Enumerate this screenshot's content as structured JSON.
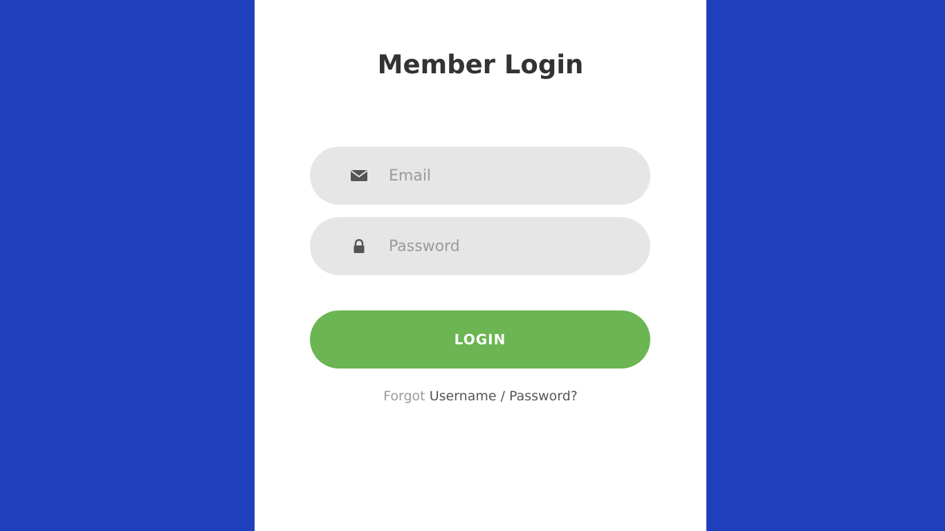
{
  "login_form": {
    "title": "Member Login",
    "email": {
      "placeholder": "Email",
      "value": "",
      "icon": "envelope-icon"
    },
    "password": {
      "placeholder": "Password",
      "value": "",
      "icon": "lock-icon"
    },
    "login_label": "LOGIN",
    "forgot_prefix": "Forgot",
    "forgot_link": "Username / Password?"
  },
  "colors": {
    "background": "#1f40bd",
    "card": "#ffffff",
    "field": "#e6e6e6",
    "button": "#6bb552",
    "title": "#333333"
  }
}
